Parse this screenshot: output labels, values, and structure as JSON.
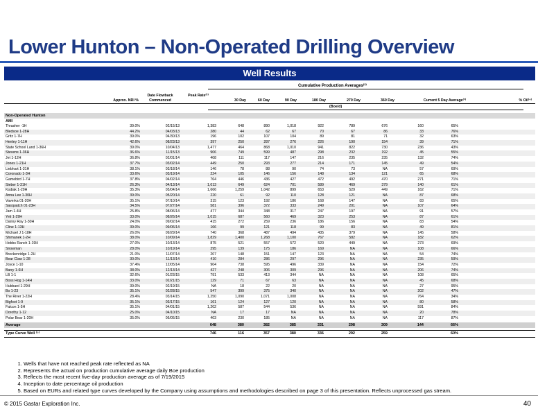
{
  "title": "Lower Hunton – Non-Operated Drilling Overview",
  "banner": "Well Results",
  "cumulative_header": "Cumulative Production Averages⁽²⁾",
  "headers": {
    "nri": "Approx. NRI %",
    "flowback": "Date Flowback Commenced",
    "peak": "Peak Rate⁽¹⁾",
    "d30": "30 Day",
    "d60": "60 Day",
    "d90": "90 Day",
    "d180": "180 Day",
    "d270": "270 Day",
    "d360": "360 Day",
    "current": "Current 5 Day Average⁽³⁾",
    "oil": "% Oil⁽⁴⁾",
    "units": "(Boe/d)"
  },
  "section": "Non-Operated Hunton",
  "subsection": "AMI",
  "wells": [
    [
      "Thrasher -1H",
      "39.0%",
      "02/15/13",
      "1,383",
      "648",
      "890",
      "1,018",
      "922",
      "789",
      "676",
      "160",
      "65%"
    ],
    [
      "Bledsoe 1-28H",
      "44.2%",
      "04/03/13",
      "280",
      "44",
      "62",
      "67",
      "70",
      "67",
      "86",
      "33",
      "76%"
    ],
    [
      "Gritz 1-7H",
      "39.0%",
      "04/30/13",
      "196",
      "102",
      "107",
      "104",
      "89",
      "81",
      "71",
      "32",
      "63%"
    ],
    [
      "Henley 1-11H",
      "42.6%",
      "08/23/13",
      "397",
      "250",
      "287",
      "276",
      "226",
      "190",
      "154",
      "39",
      "71%"
    ],
    [
      "State School Land 1-36H",
      "39.0%",
      "10/04/13",
      "1,477",
      "464",
      "868",
      "1,010",
      "941",
      "822",
      "730",
      "236",
      "43%"
    ],
    [
      "Stevens 1-36H",
      "36.6%",
      "11/15/13",
      "906",
      "749",
      "599",
      "487",
      "298",
      "232",
      "192",
      "45",
      "55%"
    ],
    [
      "Jet 1-12H",
      "36.8%",
      "02/01/14",
      "408",
      "111",
      "117",
      "147",
      "216",
      "235",
      "235",
      "132",
      "74%"
    ],
    [
      "Jones 1-21H",
      "37.7%",
      "03/02/14",
      "449",
      "250",
      "293",
      "277",
      "214",
      "171",
      "145",
      "49",
      "54%"
    ],
    [
      "Liebhart 1-31H",
      "38.1%",
      "03/18/14",
      "146",
      "78",
      "88",
      "90",
      "74",
      "73",
      "NA",
      "57",
      "69%"
    ],
    [
      "Coronado 1-3H",
      "33.6%",
      "03/19/14",
      "224",
      "105",
      "146",
      "156",
      "148",
      "134",
      "121",
      "65",
      "68%"
    ],
    [
      "Gamebird 1-7H",
      "37.8%",
      "04/02/14",
      "764",
      "446",
      "436",
      "427",
      "472",
      "492",
      "470",
      "271",
      "71%"
    ],
    [
      "Sieber 1-31H",
      "26.3%",
      "04/13/14",
      "1,013",
      "649",
      "624",
      "701",
      "589",
      "469",
      "379",
      "140",
      "61%"
    ],
    [
      "Kodiak 1-29H",
      "35.3%",
      "05/04/14",
      "1,666",
      "1,259",
      "1,042",
      "899",
      "653",
      "529",
      "449",
      "162",
      "71%"
    ],
    [
      "Anna Lee 1-30H",
      "39.0%",
      "05/20/14",
      "220",
      "61",
      "92",
      "110",
      "128",
      "121",
      "NA",
      "87",
      "68%"
    ],
    [
      "Vaverka 01-20H",
      "35.1%",
      "07/10/14",
      "315",
      "123",
      "192",
      "186",
      "168",
      "147",
      "NA",
      "83",
      "65%"
    ],
    [
      "Sasquatch 01-23H",
      "34.5%",
      "07/27/14",
      "581",
      "396",
      "372",
      "333",
      "249",
      "201",
      "NA",
      "107",
      "64%"
    ],
    [
      "Jam 1-4H",
      "25.8%",
      "08/06/14",
      "477",
      "344",
      "348",
      "317",
      "247",
      "197",
      "NA",
      "91",
      "57%"
    ],
    [
      "Yeti 1-29H",
      "33.0%",
      "08/26/14",
      "1,015",
      "687",
      "560",
      "469",
      "323",
      "253",
      "NA",
      "87",
      "61%"
    ],
    [
      "Danny Ray 1-30H",
      "24.0%",
      "09/02/14",
      "415",
      "272",
      "259",
      "236",
      "186",
      "156",
      "NA",
      "83",
      "54%"
    ],
    [
      "Cline 1-13H",
      "39.0%",
      "09/06/14",
      "166",
      "99",
      "121",
      "118",
      "99",
      "83",
      "NA",
      "49",
      "81%"
    ],
    [
      "Michael J 1-18H",
      "26.0%",
      "09/29/14",
      "740",
      "368",
      "487",
      "494",
      "435",
      "379",
      "NA",
      "145",
      "58%"
    ],
    [
      "Shimanek 1-2H",
      "38.0%",
      "10/09/14",
      "1,829",
      "1,400",
      "1,268",
      "1,100",
      "767",
      "582",
      "NA",
      "182",
      "62%"
    ],
    [
      "Hobbs Ranch 1-19H",
      "27.0%",
      "10/13/14",
      "875",
      "521",
      "557",
      "572",
      "520",
      "449",
      "NA",
      "273",
      "69%"
    ],
    [
      "Snowman",
      "28.0%",
      "10/19/14",
      "295",
      "139",
      "175",
      "186",
      "169",
      "NA",
      "NA",
      "108",
      "66%"
    ],
    [
      "Breckenridge 1-2H",
      "21.0%",
      "11/07/14",
      "207",
      "148",
      "151",
      "147",
      "123",
      "NA",
      "NA",
      "54",
      "74%"
    ],
    [
      "Bear Claw 1-28",
      "30.0%",
      "11/13/14",
      "410",
      "284",
      "286",
      "297",
      "296",
      "NA",
      "NA",
      "235",
      "59%"
    ],
    [
      "Joyce 1-10",
      "37.4%",
      "12/05/14",
      "904",
      "738",
      "595",
      "496",
      "339",
      "NA",
      "NA",
      "154",
      "72%"
    ],
    [
      "Barry 1-6H",
      "38.0%",
      "12/13/14",
      "427",
      "248",
      "306",
      "309",
      "296",
      "NA",
      "NA",
      "206",
      "74%"
    ],
    [
      "LB 1-1",
      "32.6%",
      "01/23/15",
      "791",
      "533",
      "413",
      "344",
      "NA",
      "NA",
      "NA",
      "108",
      "65%"
    ],
    [
      "Boss Hog 1-14H",
      "33.0%",
      "02/21/15",
      "129",
      "71",
      "67",
      "63",
      "NA",
      "NA",
      "NA",
      "45",
      "68%"
    ],
    [
      "Hubbard 1-29H",
      "39.0%",
      "02/19/15",
      "NA",
      "18",
      "22",
      "20",
      "NA",
      "NA",
      "NA",
      "27",
      "95%"
    ],
    [
      "Bo 1-23",
      "35.1%",
      "02/28/15",
      "547",
      "399",
      "375",
      "340",
      "NA",
      "NA",
      "NA",
      "202",
      "47%"
    ],
    [
      "The River 1-22H",
      "28.4%",
      "03/14/15",
      "1,250",
      "1,090",
      "1,071",
      "1,008",
      "NA",
      "NA",
      "NA",
      "764",
      "34%"
    ],
    [
      "Bigfoot 1-9",
      "35.1%",
      "03/17/15",
      "161",
      "124",
      "127",
      "120",
      "NA",
      "NA",
      "NA",
      "80",
      "58%"
    ],
    [
      "Falcon 1-5H",
      "35.1%",
      "04/01/15",
      "1,202",
      "587",
      "544",
      "536",
      "NA",
      "NA",
      "NA",
      "591",
      "84%"
    ],
    [
      "Dorothy 1-12",
      "25.0%",
      "04/10/15",
      "NA",
      "17",
      "17",
      "NA",
      "NA",
      "NA",
      "NA",
      "20",
      "78%"
    ],
    [
      "Polar Bear 1-20H",
      "35.0%",
      "05/05/15",
      "403",
      "230",
      "185",
      "NA",
      "NA",
      "NA",
      "NA",
      "117",
      "87%"
    ]
  ],
  "average": [
    "Average",
    "",
    "",
    "648",
    "380",
    "382",
    "385",
    "331",
    "298",
    "309",
    "144",
    "66%"
  ],
  "type_curve": [
    "Type Curve Well ⁽⁵⁾",
    "",
    "",
    "746",
    "116",
    "357",
    "380",
    "336",
    "292",
    "259",
    "",
    "60%"
  ],
  "notes": [
    "Wells that have not reached peak rate reflected as NA",
    "Represents the actual on production cumulative average daily Boe production",
    "Reflects the most recent five-day production average as of 7/19/2015",
    "Inception to date percentage oil production",
    "Based on EURs and related type curves developed by the Company using assumptions and methodologies described on page 3 of this presentation. Reflects unprocessed gas stream."
  ],
  "copyright": "© 2015 Gastar Exploration Inc.",
  "page_number": "40"
}
